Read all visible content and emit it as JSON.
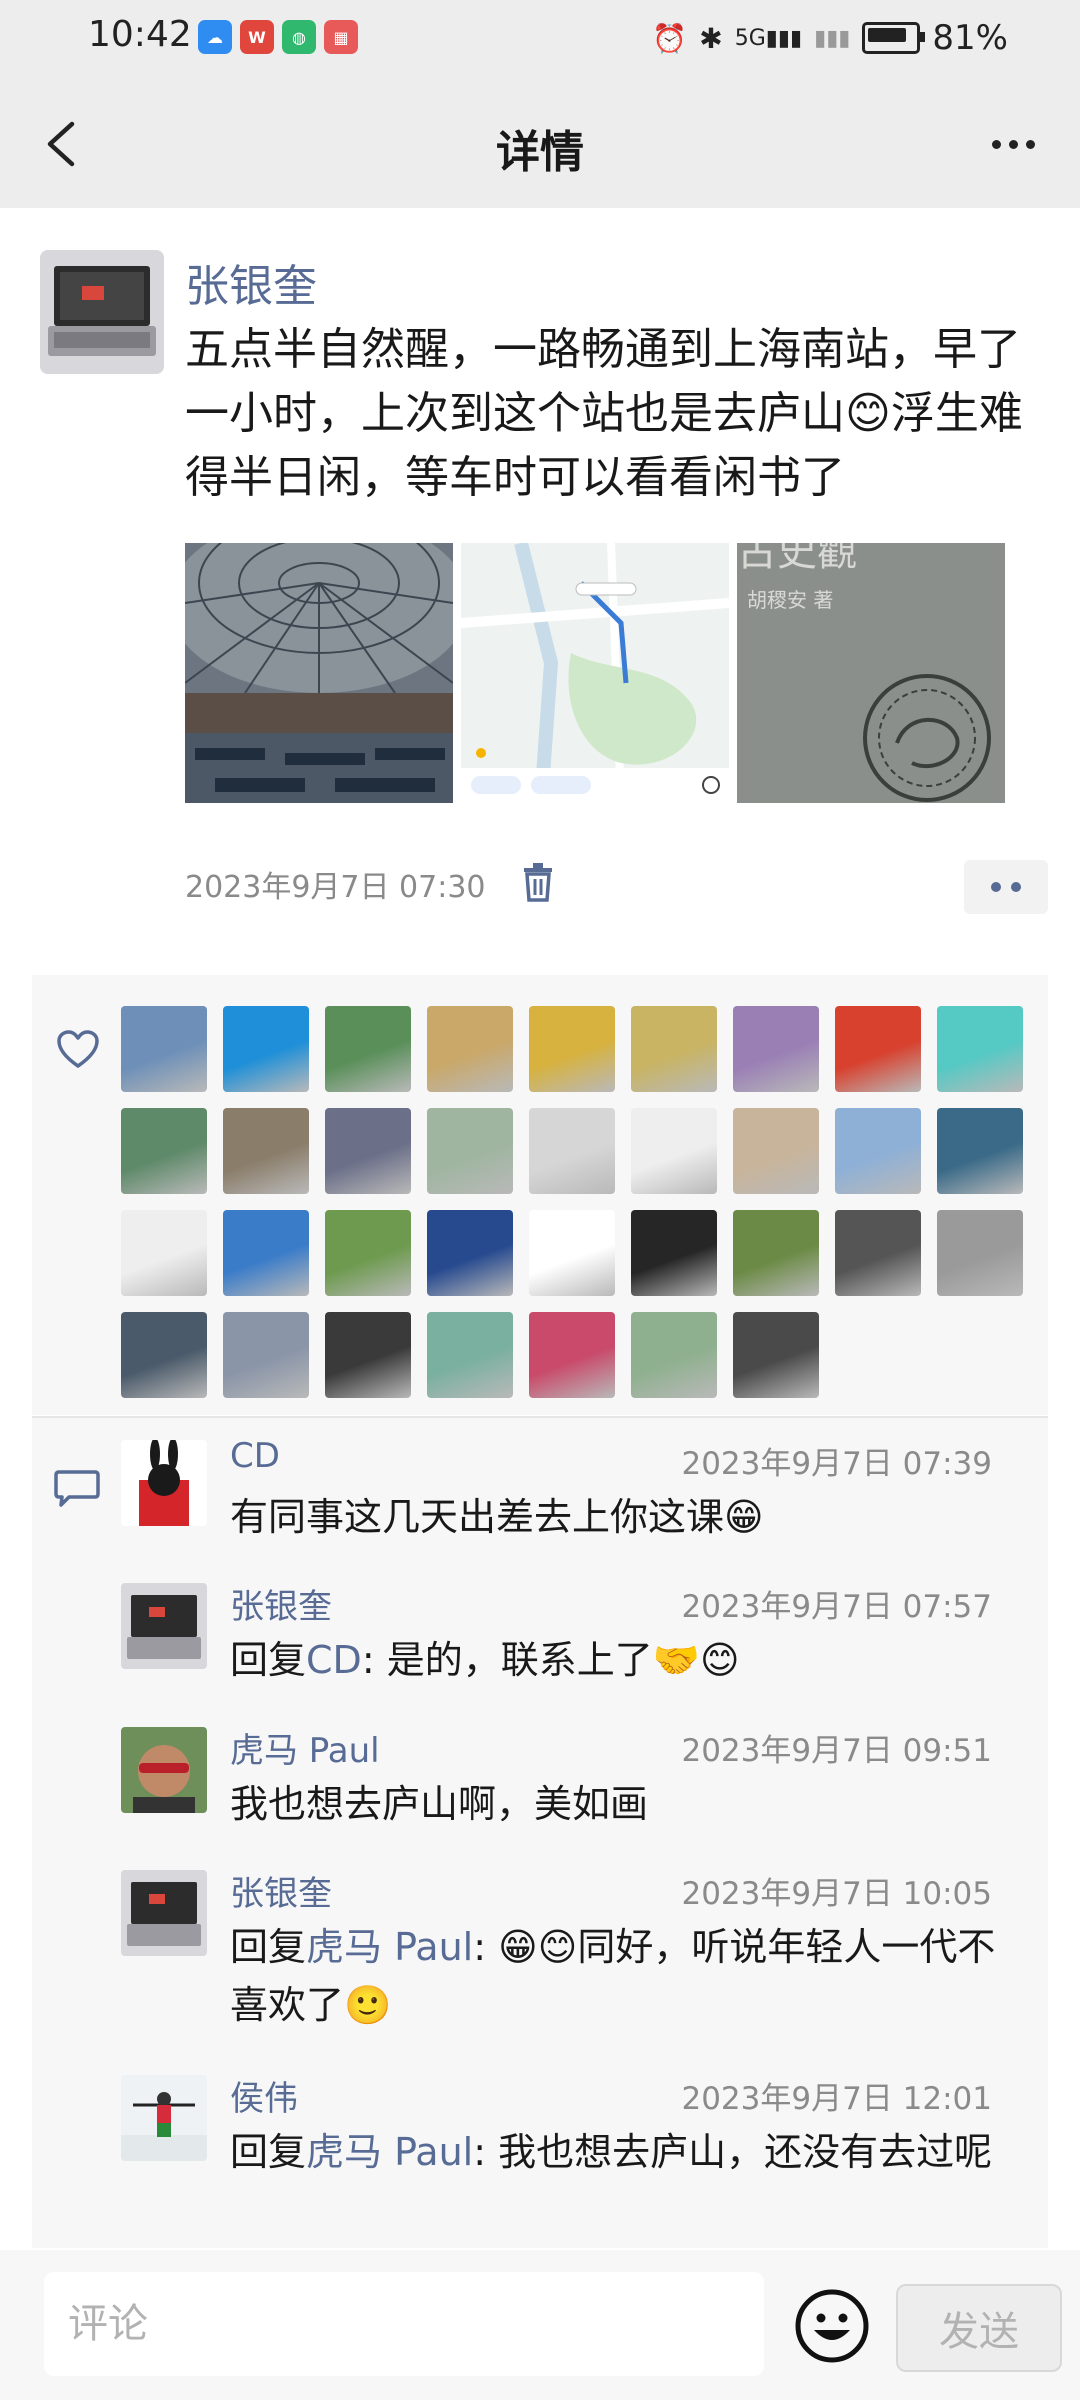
{
  "status_bar": {
    "time": "10:42",
    "network": "5G",
    "battery": "81%"
  },
  "title_bar": {
    "title": "详情"
  },
  "post": {
    "author": "张银奎",
    "text": "五点半自然醒，一路畅通到上海南站，早了一小时，上次到这个站也是去庐山😊浮生难得半日闲，等车时可以看看闲书了",
    "photos": [
      {
        "name": "station-dome-photo"
      },
      {
        "name": "map-screenshot-photo"
      },
      {
        "name": "book-cover-photo",
        "caption": "古史觀",
        "subcaption": "胡稷安 著"
      }
    ],
    "time": "2023年9月7日 07:30"
  },
  "likes": {
    "colors": [
      "#6d8fb8",
      "#1e8fd8",
      "#5a8f5a",
      "#c9a86a",
      "#d7b23f",
      "#c8b463",
      "#9a7fb5",
      "#d8412e",
      "#55c9c4",
      "#5f8a6a",
      "#8a7d6a",
      "#6b6f88",
      "#9fb5a0",
      "#d6d6d6",
      "#eeeeee",
      "#c8b49a",
      "#8fb0d6",
      "#3a6a88",
      "#eeeeee",
      "#3b7cc9",
      "#6d9a4e",
      "#274a8f",
      "#ffffff",
      "#262626",
      "#6b8a45",
      "#555555",
      "#9a9a9a",
      "#4a5a6a",
      "#8a95a8",
      "#3a3a3a",
      "#7ab0a0",
      "#c94a6a",
      "#8fb08f",
      "#4a4a4a"
    ]
  },
  "comments": [
    {
      "name": "CD",
      "time": "2023年9月7日 07:39",
      "text": "有同事这几天出差去上你这课😁"
    },
    {
      "name": "张银奎",
      "time": "2023年9月7日 07:57",
      "prefix": "回复",
      "mention": "CD",
      "text": ": 是的，联系上了🤝😊"
    },
    {
      "name": "虎马 Paul",
      "time": "2023年9月7日 09:51",
      "text": "我也想去庐山啊，美如画"
    },
    {
      "name": "张银奎",
      "time": "2023年9月7日 10:05",
      "prefix": "回复",
      "mention": "虎马 Paul",
      "text": ": 😁😊同好，听说年轻人一代不喜欢了🙂"
    },
    {
      "name": "侯伟",
      "time": "2023年9月7日 12:01",
      "prefix": "回复",
      "mention": "虎马 Paul",
      "text": ": 我也想去庐山，还没有去过呢"
    }
  ],
  "input": {
    "placeholder": "评论",
    "send_label": "发送"
  },
  "accent": "#576b95"
}
